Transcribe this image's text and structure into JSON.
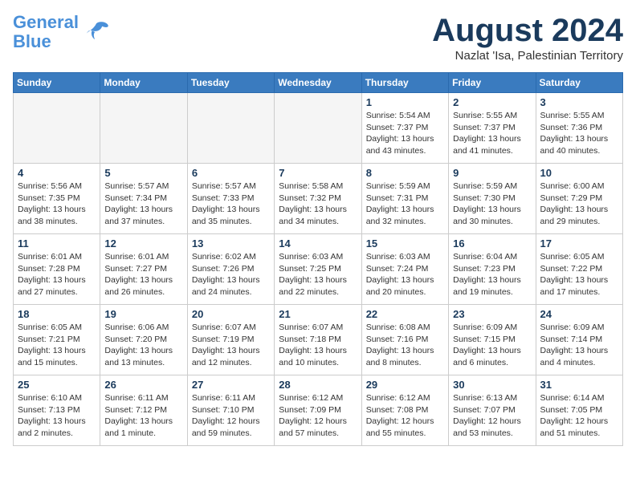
{
  "header": {
    "logo_line1": "General",
    "logo_line2": "Blue",
    "month_title": "August 2024",
    "location": "Nazlat 'Isa, Palestinian Territory"
  },
  "weekdays": [
    "Sunday",
    "Monday",
    "Tuesday",
    "Wednesday",
    "Thursday",
    "Friday",
    "Saturday"
  ],
  "weeks": [
    [
      {
        "num": "",
        "info": ""
      },
      {
        "num": "",
        "info": ""
      },
      {
        "num": "",
        "info": ""
      },
      {
        "num": "",
        "info": ""
      },
      {
        "num": "1",
        "info": "Sunrise: 5:54 AM\nSunset: 7:37 PM\nDaylight: 13 hours\nand 43 minutes."
      },
      {
        "num": "2",
        "info": "Sunrise: 5:55 AM\nSunset: 7:37 PM\nDaylight: 13 hours\nand 41 minutes."
      },
      {
        "num": "3",
        "info": "Sunrise: 5:55 AM\nSunset: 7:36 PM\nDaylight: 13 hours\nand 40 minutes."
      }
    ],
    [
      {
        "num": "4",
        "info": "Sunrise: 5:56 AM\nSunset: 7:35 PM\nDaylight: 13 hours\nand 38 minutes."
      },
      {
        "num": "5",
        "info": "Sunrise: 5:57 AM\nSunset: 7:34 PM\nDaylight: 13 hours\nand 37 minutes."
      },
      {
        "num": "6",
        "info": "Sunrise: 5:57 AM\nSunset: 7:33 PM\nDaylight: 13 hours\nand 35 minutes."
      },
      {
        "num": "7",
        "info": "Sunrise: 5:58 AM\nSunset: 7:32 PM\nDaylight: 13 hours\nand 34 minutes."
      },
      {
        "num": "8",
        "info": "Sunrise: 5:59 AM\nSunset: 7:31 PM\nDaylight: 13 hours\nand 32 minutes."
      },
      {
        "num": "9",
        "info": "Sunrise: 5:59 AM\nSunset: 7:30 PM\nDaylight: 13 hours\nand 30 minutes."
      },
      {
        "num": "10",
        "info": "Sunrise: 6:00 AM\nSunset: 7:29 PM\nDaylight: 13 hours\nand 29 minutes."
      }
    ],
    [
      {
        "num": "11",
        "info": "Sunrise: 6:01 AM\nSunset: 7:28 PM\nDaylight: 13 hours\nand 27 minutes."
      },
      {
        "num": "12",
        "info": "Sunrise: 6:01 AM\nSunset: 7:27 PM\nDaylight: 13 hours\nand 26 minutes."
      },
      {
        "num": "13",
        "info": "Sunrise: 6:02 AM\nSunset: 7:26 PM\nDaylight: 13 hours\nand 24 minutes."
      },
      {
        "num": "14",
        "info": "Sunrise: 6:03 AM\nSunset: 7:25 PM\nDaylight: 13 hours\nand 22 minutes."
      },
      {
        "num": "15",
        "info": "Sunrise: 6:03 AM\nSunset: 7:24 PM\nDaylight: 13 hours\nand 20 minutes."
      },
      {
        "num": "16",
        "info": "Sunrise: 6:04 AM\nSunset: 7:23 PM\nDaylight: 13 hours\nand 19 minutes."
      },
      {
        "num": "17",
        "info": "Sunrise: 6:05 AM\nSunset: 7:22 PM\nDaylight: 13 hours\nand 17 minutes."
      }
    ],
    [
      {
        "num": "18",
        "info": "Sunrise: 6:05 AM\nSunset: 7:21 PM\nDaylight: 13 hours\nand 15 minutes."
      },
      {
        "num": "19",
        "info": "Sunrise: 6:06 AM\nSunset: 7:20 PM\nDaylight: 13 hours\nand 13 minutes."
      },
      {
        "num": "20",
        "info": "Sunrise: 6:07 AM\nSunset: 7:19 PM\nDaylight: 13 hours\nand 12 minutes."
      },
      {
        "num": "21",
        "info": "Sunrise: 6:07 AM\nSunset: 7:18 PM\nDaylight: 13 hours\nand 10 minutes."
      },
      {
        "num": "22",
        "info": "Sunrise: 6:08 AM\nSunset: 7:16 PM\nDaylight: 13 hours\nand 8 minutes."
      },
      {
        "num": "23",
        "info": "Sunrise: 6:09 AM\nSunset: 7:15 PM\nDaylight: 13 hours\nand 6 minutes."
      },
      {
        "num": "24",
        "info": "Sunrise: 6:09 AM\nSunset: 7:14 PM\nDaylight: 13 hours\nand 4 minutes."
      }
    ],
    [
      {
        "num": "25",
        "info": "Sunrise: 6:10 AM\nSunset: 7:13 PM\nDaylight: 13 hours\nand 2 minutes."
      },
      {
        "num": "26",
        "info": "Sunrise: 6:11 AM\nSunset: 7:12 PM\nDaylight: 13 hours\nand 1 minute."
      },
      {
        "num": "27",
        "info": "Sunrise: 6:11 AM\nSunset: 7:10 PM\nDaylight: 12 hours\nand 59 minutes."
      },
      {
        "num": "28",
        "info": "Sunrise: 6:12 AM\nSunset: 7:09 PM\nDaylight: 12 hours\nand 57 minutes."
      },
      {
        "num": "29",
        "info": "Sunrise: 6:12 AM\nSunset: 7:08 PM\nDaylight: 12 hours\nand 55 minutes."
      },
      {
        "num": "30",
        "info": "Sunrise: 6:13 AM\nSunset: 7:07 PM\nDaylight: 12 hours\nand 53 minutes."
      },
      {
        "num": "31",
        "info": "Sunrise: 6:14 AM\nSunset: 7:05 PM\nDaylight: 12 hours\nand 51 minutes."
      }
    ]
  ]
}
